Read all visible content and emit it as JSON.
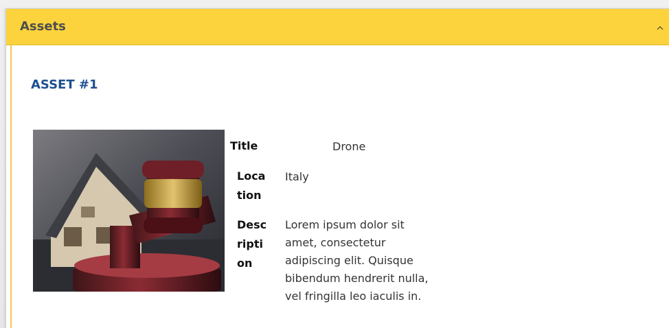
{
  "panel": {
    "title": "Assets",
    "collapse_icon": "chevron-up-icon",
    "accent_color": "#fcd33d"
  },
  "asset": {
    "heading": "ASSET #1",
    "image_name": "house-and-gavel-image",
    "fields": [
      {
        "label": "Title",
        "value": "Drone"
      },
      {
        "label": "Location",
        "value": "Italy"
      },
      {
        "label": "Description",
        "value": "Lorem ipsum dolor sit amet, consectetur adipiscing elit. Quisque bibendum hendrerit nulla, vel fringilla leo iaculis in."
      }
    ]
  }
}
